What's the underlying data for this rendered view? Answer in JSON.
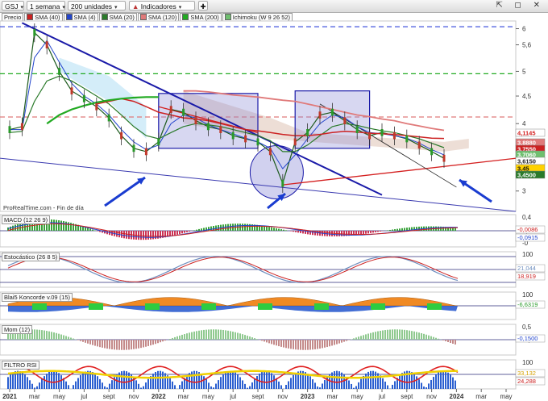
{
  "toolbar": {
    "ticker": "GSJ",
    "timeframe": "1 semana",
    "units": "200 unidades",
    "indicators": "Indicadores",
    "right_icons": "⇱ ◻ ✕"
  },
  "legend": [
    {
      "label": "Precio",
      "color": "#ffffff"
    },
    {
      "label": "SMA (40)",
      "color": "#cc2222"
    },
    {
      "label": "SMA (4)",
      "color": "#2244cc"
    },
    {
      "label": "SMA (20)",
      "color": "#2a7a2a"
    },
    {
      "label": "SMA (120)",
      "color": "#e07a7a"
    },
    {
      "label": "SMA (200)",
      "color": "#22aa22"
    },
    {
      "label": "Ichimoku (W 9 26 52)",
      "color": "#6fbf6f"
    }
  ],
  "footer": {
    "brand": "ProRealTime.com - Fin de día"
  },
  "price_panel": {
    "y_ticks": [
      "6",
      "5,6",
      "5",
      "4,5",
      "4",
      "3,5",
      "3"
    ],
    "tags": [
      {
        "text": "4,1145",
        "bg": "#ffffff",
        "fg": "#d42020"
      },
      {
        "text": "3,8880",
        "bg": "#e07a7a",
        "fg": "#ffffff"
      },
      {
        "text": "3,7550",
        "bg": "#cc2222",
        "fg": "#ffffff"
      },
      {
        "text": "3,7060",
        "bg": "#6fbf6f",
        "fg": "#ffffff"
      },
      {
        "text": "3,6150",
        "bg": "#ffffff",
        "fg": "#222222"
      },
      {
        "text": "3,45",
        "bg": "#ffd200",
        "fg": "#111111"
      },
      {
        "text": "3,4500",
        "bg": "#2a7a2a",
        "fg": "#ffffff"
      }
    ]
  },
  "panels": [
    {
      "key": "macd",
      "title": "MACD (12 26 9)",
      "ticks": [
        "0,4",
        "0,2",
        "-0"
      ],
      "tags": [
        {
          "text": "-0,0086",
          "bg": "#ffffff",
          "fg": "#cc2222"
        },
        {
          "text": "-0,0915",
          "bg": "#ffffff",
          "fg": "#2244cc"
        }
      ]
    },
    {
      "key": "stoch",
      "title": "Estocástico (26 8 5)",
      "ticks": [
        "100",
        "50"
      ],
      "tags": [
        {
          "text": "21,044",
          "bg": "#ffffff",
          "fg": "#6f8fbf"
        },
        {
          "text": "18,919",
          "bg": "#ffffff",
          "fg": "#cc2222"
        }
      ]
    },
    {
      "key": "koncorde",
      "title": "Blai5 Koncorde v.09 (15)",
      "ticks": [
        "100",
        "0"
      ],
      "tags": [
        {
          "text": "-6,6319",
          "bg": "#ffffff",
          "fg": "#2a9a2a"
        }
      ]
    },
    {
      "key": "mom",
      "title": "Mom (12)",
      "ticks": [
        "0,5",
        "-0,1500"
      ],
      "tags": [
        {
          "text": "-0,1500",
          "bg": "#ffffff",
          "fg": "#2244cc"
        }
      ]
    },
    {
      "key": "rsi",
      "title": "FILTRO RSI",
      "ticks": [
        "100",
        "50"
      ],
      "tags": [
        {
          "text": "33,132",
          "bg": "#ffffff",
          "fg": "#d4a000"
        },
        {
          "text": "24,288",
          "bg": "#ffffff",
          "fg": "#cc2222"
        }
      ]
    }
  ],
  "x_axis": [
    "2021",
    "mar",
    "may",
    "jul",
    "sept",
    "nov",
    "2022",
    "mar",
    "may",
    "jul",
    "sept",
    "nov",
    "2023",
    "mar",
    "may",
    "jul",
    "sept",
    "nov",
    "2024",
    "mar",
    "may"
  ],
  "chart_data": {
    "type": "line",
    "title": "",
    "instrument": "GSJ",
    "interval": "1 semana",
    "y_scale": "log",
    "ylim": [
      2.75,
      6.2
    ],
    "x_range": [
      "2021-01",
      "2024-05"
    ],
    "series": [
      {
        "name": "Precio",
        "x": [
          "2021-01",
          "2021-02",
          "2021-03",
          "2021-04",
          "2021-05",
          "2021-06",
          "2021-07",
          "2021-08",
          "2021-09",
          "2021-10",
          "2021-11",
          "2021-12",
          "2022-01",
          "2022-02",
          "2022-03",
          "2022-04",
          "2022-05",
          "2022-06",
          "2022-07",
          "2022-08",
          "2022-09",
          "2022-10",
          "2022-11",
          "2022-12",
          "2023-01",
          "2023-02",
          "2023-03",
          "2023-04",
          "2023-05",
          "2023-06",
          "2023-07",
          "2023-08",
          "2023-09",
          "2023-10",
          "2023-11",
          "2023-12"
        ],
        "values": [
          3.9,
          3.95,
          5.9,
          5.6,
          5.0,
          4.6,
          4.45,
          4.3,
          4.1,
          3.8,
          3.6,
          3.55,
          3.7,
          4.25,
          4.2,
          4.05,
          3.95,
          3.9,
          3.8,
          3.75,
          3.7,
          3.55,
          3.1,
          3.7,
          3.85,
          4.15,
          4.2,
          4.05,
          3.9,
          3.8,
          3.85,
          3.8,
          3.75,
          3.65,
          3.55,
          3.45
        ]
      },
      {
        "name": "SMA (4)",
        "values": [
          3.9,
          3.9,
          5.3,
          5.7,
          5.2,
          4.75,
          4.5,
          4.35,
          4.15,
          3.9,
          3.7,
          3.58,
          3.65,
          4.0,
          4.15,
          4.1,
          3.98,
          3.9,
          3.83,
          3.76,
          3.7,
          3.6,
          3.3,
          3.5,
          3.75,
          4.0,
          4.15,
          4.1,
          3.95,
          3.85,
          3.83,
          3.8,
          3.76,
          3.68,
          3.58,
          3.5
        ]
      },
      {
        "name": "SMA (20)",
        "values": [
          3.85,
          3.87,
          4.4,
          4.8,
          4.9,
          4.8,
          4.65,
          4.5,
          4.35,
          4.15,
          3.95,
          3.8,
          3.75,
          3.85,
          3.95,
          4.0,
          3.98,
          3.95,
          3.9,
          3.85,
          3.8,
          3.72,
          3.55,
          3.55,
          3.65,
          3.8,
          3.95,
          4.0,
          3.97,
          3.92,
          3.88,
          3.85,
          3.8,
          3.75,
          3.68,
          3.61
        ]
      },
      {
        "name": "SMA (40)",
        "values": [
          null,
          null,
          null,
          null,
          null,
          null,
          null,
          4.35,
          4.4,
          4.45,
          4.4,
          4.3,
          4.2,
          4.15,
          4.1,
          4.08,
          4.05,
          4.0,
          3.95,
          3.9,
          3.88,
          3.85,
          3.82,
          3.8,
          3.8,
          3.82,
          3.85,
          3.87,
          3.86,
          3.84,
          3.83,
          3.82,
          3.8,
          3.78,
          3.76,
          3.755
        ]
      },
      {
        "name": "SMA (120)",
        "values": [
          null,
          null,
          null,
          null,
          null,
          null,
          null,
          null,
          null,
          null,
          null,
          null,
          null,
          null,
          4.6,
          4.6,
          4.58,
          4.55,
          4.52,
          4.5,
          4.48,
          4.45,
          4.42,
          4.4,
          4.35,
          4.3,
          4.25,
          4.2,
          4.15,
          4.12,
          4.08,
          4.05,
          4.0,
          3.96,
          3.92,
          3.888
        ]
      },
      {
        "name": "SMA (200)",
        "values": [
          null,
          null,
          null,
          4.0,
          4.15,
          4.25,
          4.32,
          4.38,
          4.42,
          4.45,
          4.47,
          4.48,
          4.48,
          null,
          null,
          null,
          null,
          null,
          null,
          null,
          null,
          null,
          null,
          null,
          null,
          null,
          null,
          null,
          null,
          null,
          null,
          null,
          null,
          null,
          null,
          null
        ]
      }
    ],
    "reference_lines": [
      {
        "style": "dashed",
        "color": "#4455dd",
        "y": 6.05
      },
      {
        "style": "dashed",
        "color": "#22aa22",
        "y": 4.95
      },
      {
        "style": "dashed",
        "color": "#e07a7a",
        "y": 4.1145
      }
    ],
    "annotations": [
      "downtrend-line",
      "support-line",
      "rectangle-2022",
      "rectangle-2023",
      "circle-low-2022",
      "arrows"
    ]
  }
}
